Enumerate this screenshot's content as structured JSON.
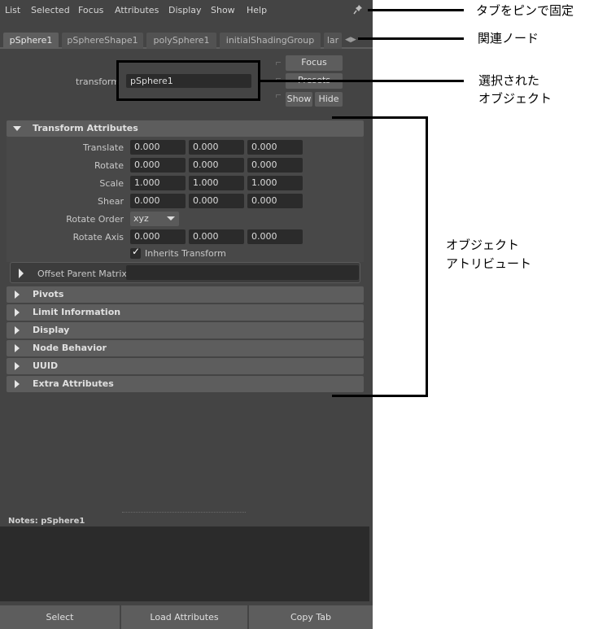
{
  "menu": [
    "List",
    "Selected",
    "Focus",
    "Attributes",
    "Display",
    "Show",
    "Help"
  ],
  "tabs": [
    "pSphere1",
    "pSphereShape1",
    "polySphere1",
    "initialShadingGroup",
    "lar"
  ],
  "node": {
    "type_label": "transform",
    "name_value": "pSphere1",
    "focus_label": "Focus",
    "presets_label": "Presets",
    "show_label": "Show",
    "hide_label": "Hide"
  },
  "transform_section": {
    "title": "Transform Attributes",
    "rows": [
      {
        "label": "Translate",
        "values": [
          "0.000",
          "0.000",
          "0.000"
        ]
      },
      {
        "label": "Rotate",
        "values": [
          "0.000",
          "0.000",
          "0.000"
        ]
      },
      {
        "label": "Scale",
        "values": [
          "1.000",
          "1.000",
          "1.000"
        ]
      },
      {
        "label": "Shear",
        "values": [
          "0.000",
          "0.000",
          "0.000"
        ]
      }
    ],
    "rotate_order_label": "Rotate Order",
    "rotate_order_value": "xyz",
    "rotate_axis_label": "Rotate Axis",
    "rotate_axis_values": [
      "0.000",
      "0.000",
      "0.000"
    ],
    "inherits_label": "Inherits Transform",
    "inherits_checked": true,
    "offset_parent_label": "Offset Parent Matrix"
  },
  "collapsed_sections": [
    "Pivots",
    "Limit Information",
    "Display",
    "Node Behavior",
    "UUID",
    "Extra Attributes"
  ],
  "notes_label": "Notes:  pSphere1",
  "bottom_buttons": [
    "Select",
    "Load Attributes",
    "Copy Tab"
  ],
  "annotations": {
    "pin": "タブをピンで固定",
    "related": "関連ノード",
    "selected_line1": "選択された",
    "selected_line2": "オブジェクト",
    "attributes_line1": "オブジェクト",
    "attributes_line2": "アトリビュート"
  },
  "icons": {
    "pin": "pin-icon",
    "expand": "triangle-right-icon",
    "collapse": "triangle-down-icon"
  },
  "colors": {
    "panel_bg": "#444444",
    "field_bg": "#2b2b2b",
    "section_bg": "#5d5d5d",
    "annotation": "#000000"
  }
}
